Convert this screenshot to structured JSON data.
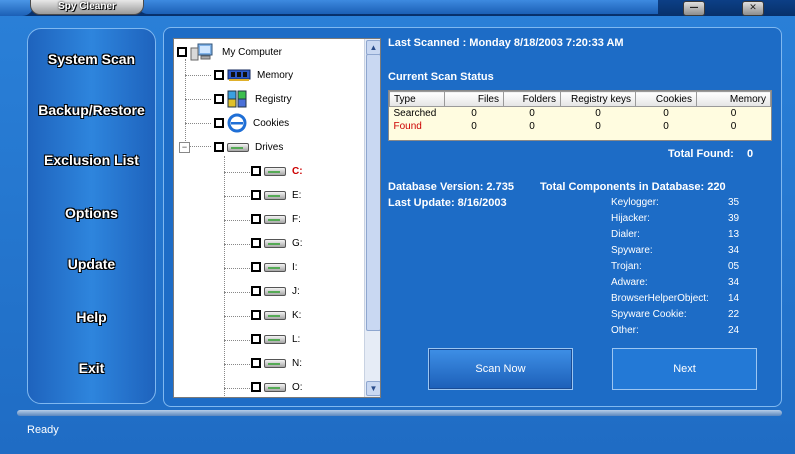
{
  "window": {
    "title": "Spy Cleaner",
    "minimize_glyph": "—",
    "close_glyph": "✕",
    "colors": {
      "frame": "#2a80d8",
      "title_bar": "#07306a",
      "found": "#cc0000"
    }
  },
  "sidebar": {
    "items": [
      {
        "label": "System Scan"
      },
      {
        "label": "Backup/Restore"
      },
      {
        "label": "Exclusion List"
      },
      {
        "label": "Options"
      },
      {
        "label": "Update"
      },
      {
        "label": "Help"
      },
      {
        "label": "Exit"
      }
    ]
  },
  "tree": {
    "root": {
      "label": "My Computer",
      "icon": "computer-icon",
      "checked": false
    },
    "children": [
      {
        "label": "Memory",
        "icon": "memory-chip-icon",
        "checked": false
      },
      {
        "label": "Registry",
        "icon": "registry-icon",
        "checked": false
      },
      {
        "label": "Cookies",
        "icon": "browser-cookie-icon",
        "checked": false
      },
      {
        "label": "Drives",
        "icon": "drive-icon",
        "checked": false,
        "expanded": true,
        "expander_glyph": "−"
      }
    ],
    "drives": [
      {
        "label": "C:",
        "highlight": true
      },
      {
        "label": "E:"
      },
      {
        "label": "F:"
      },
      {
        "label": "G:"
      },
      {
        "label": "I:"
      },
      {
        "label": "J:"
      },
      {
        "label": "K:"
      },
      {
        "label": "L:"
      },
      {
        "label": "N:"
      },
      {
        "label": "O:"
      }
    ]
  },
  "scan": {
    "last_scanned": "Last Scanned : Monday 8/18/2003 7:20:33 AM",
    "status_title": "Current Scan Status",
    "table": {
      "headers": [
        "Type",
        "Files",
        "Folders",
        "Registry keys",
        "Cookies",
        "Memory"
      ],
      "rows": [
        [
          "Searched",
          "0",
          "0",
          "0",
          "0",
          "0"
        ],
        [
          "Found",
          "0",
          "0",
          "0",
          "0",
          "0"
        ]
      ]
    },
    "total_found_label": "Total Found:",
    "total_found_value": "0"
  },
  "database": {
    "version_label": "Database Version: 2.735",
    "total_label": "Total Components in Database: 220",
    "last_update_label": "Last Update: 8/16/2003",
    "components": [
      {
        "name": "Keylogger:",
        "count": "35"
      },
      {
        "name": "Hijacker:",
        "count": "39"
      },
      {
        "name": "Dialer:",
        "count": "13"
      },
      {
        "name": "Spyware:",
        "count": "34"
      },
      {
        "name": "Trojan:",
        "count": "05"
      },
      {
        "name": "Adware:",
        "count": "34"
      },
      {
        "name": "BrowserHelperObject:",
        "count": "14"
      },
      {
        "name": "Spyware Cookie:",
        "count": "22"
      },
      {
        "name": "Other:",
        "count": "24"
      }
    ]
  },
  "actions": {
    "scan_now": "Scan Now",
    "next": "Next"
  },
  "status_bar": {
    "text": "Ready"
  }
}
